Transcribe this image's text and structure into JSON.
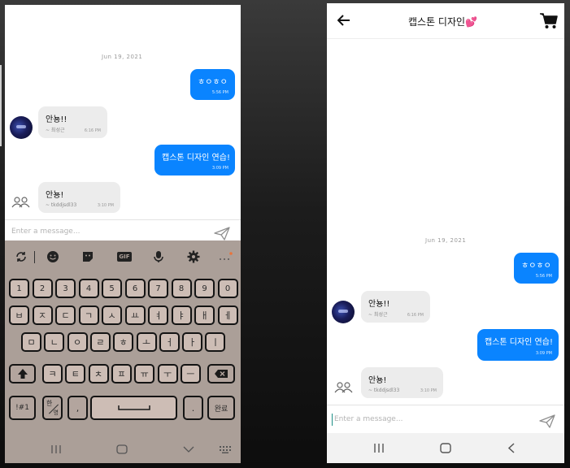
{
  "conversation": {
    "date": "Jun 19, 2021",
    "messages": [
      {
        "direction": "out",
        "text": "ㅎㅇㅎㅇ",
        "time": "5:56 PM"
      },
      {
        "direction": "in",
        "text": "안뇽!!",
        "sender": "~ 최성근",
        "time": "6:16 PM"
      },
      {
        "direction": "out",
        "text": "캡스톤 디자인 연습!",
        "time": "3:09 PM"
      },
      {
        "direction": "in",
        "text": "안뇽!",
        "sender": "~ tkddjsdl33",
        "time": "3:10 PM"
      }
    ]
  },
  "composer": {
    "placeholder": "Enter a message..."
  },
  "header": {
    "title": "캡스톤 디자인",
    "emoji": "💕",
    "back_icon": "arrow-left-icon",
    "cart_icon": "shopping-cart-icon"
  },
  "keyboard": {
    "toolbar": [
      "rotate-icon",
      "emoji-icon",
      "sticker-icon",
      "gif-icon",
      "mic-icon",
      "gear-icon",
      "more-icon"
    ],
    "gif_label": "GIF",
    "row_numbers": [
      "1",
      "2",
      "3",
      "4",
      "5",
      "6",
      "7",
      "8",
      "9",
      "0"
    ],
    "row1": [
      "ㅂ",
      "ㅈ",
      "ㄷ",
      "ㄱ",
      "ㅅ",
      "ㅛ",
      "ㅕ",
      "ㅑ",
      "ㅐ",
      "ㅔ"
    ],
    "row2": [
      "ㅁ",
      "ㄴ",
      "ㅇ",
      "ㄹ",
      "ㅎ",
      "ㅗ",
      "ㅓ",
      "ㅏ",
      "ㅣ"
    ],
    "row3": [
      "ㅋ",
      "ㅌ",
      "ㅊ",
      "ㅍ",
      "ㅠ",
      "ㅜ",
      "ㅡ"
    ],
    "symbols_label": "!#1",
    "lang_label": "한",
    "lang_sub": "영",
    "comma": ",",
    "period": ".",
    "done_label": "완료"
  }
}
